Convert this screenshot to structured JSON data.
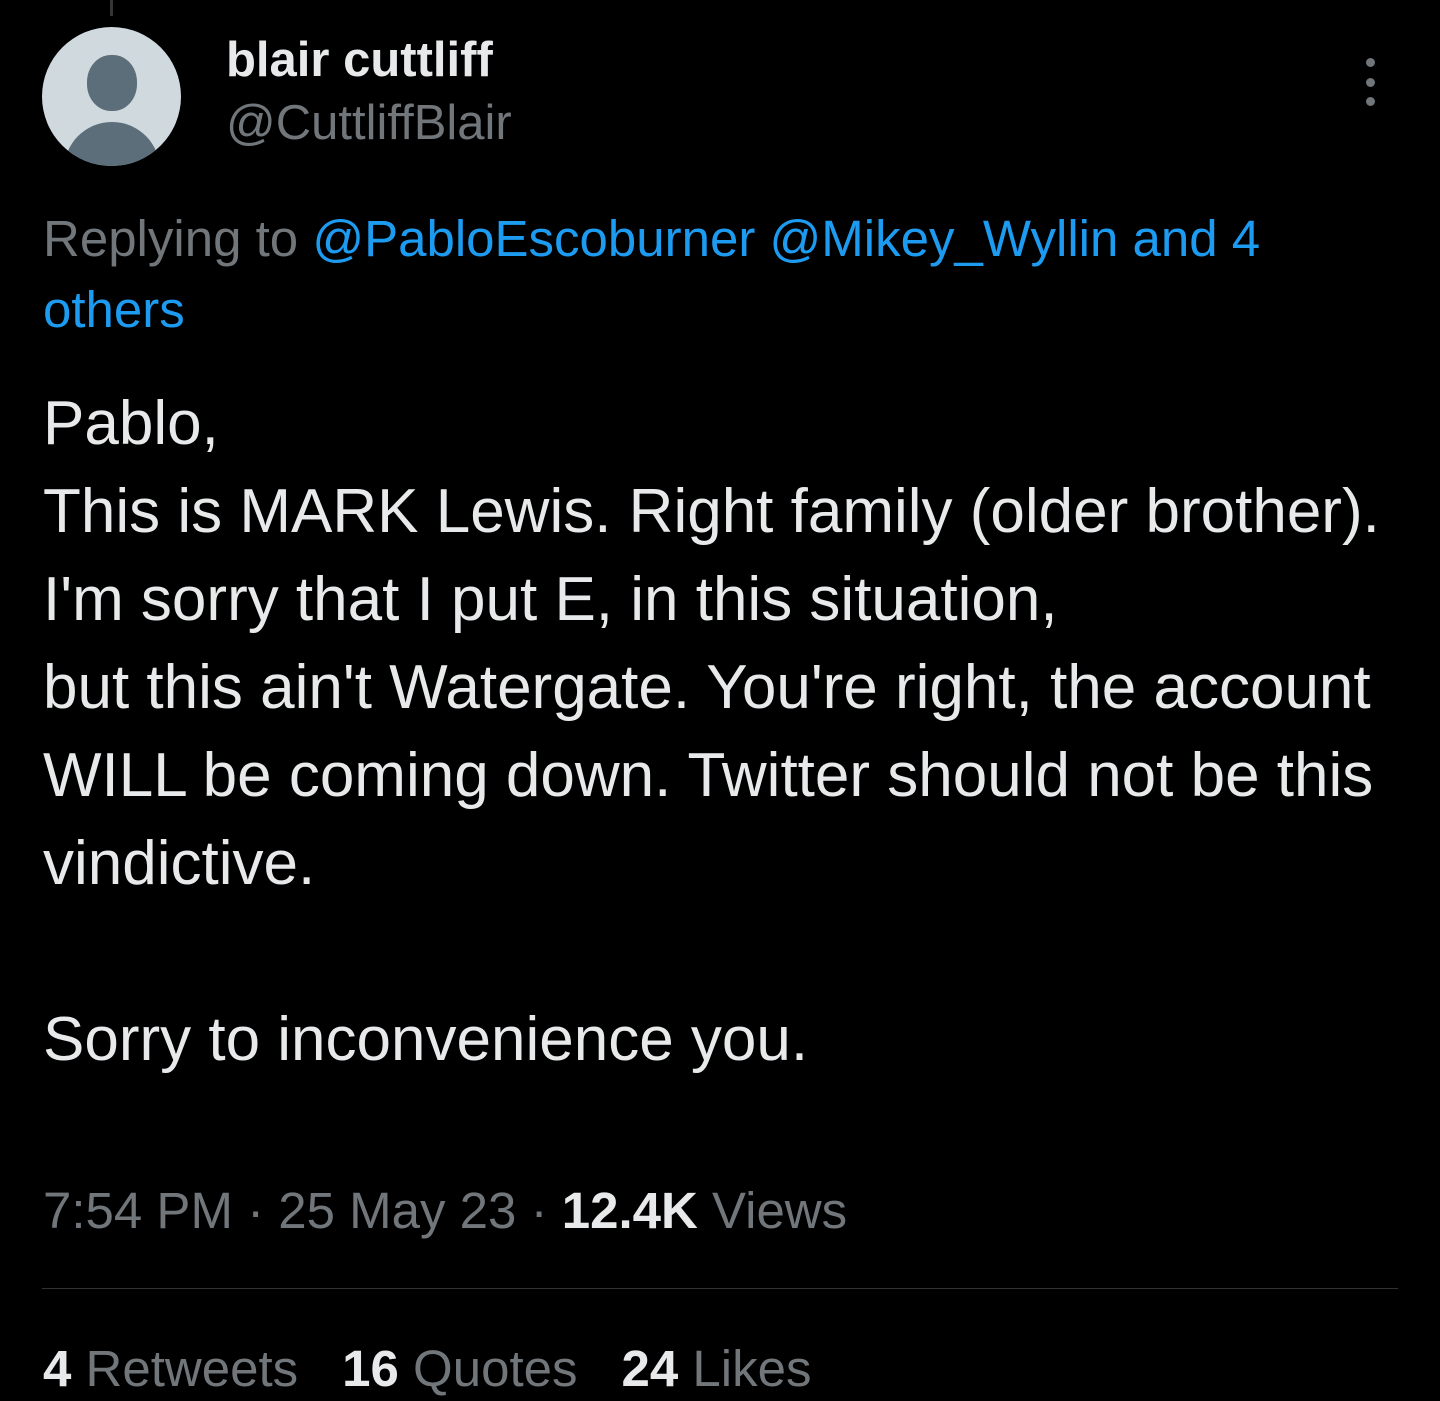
{
  "author": {
    "display_name": "blair cuttliff",
    "handle": "@CuttliffBlair",
    "avatar_icon": "default-profile-avatar-icon"
  },
  "menu": {
    "more_icon": "more-vertical-icon"
  },
  "reply": {
    "prefix": "Replying to",
    "mentions": [
      "@PabloEscoburner",
      "@Mikey_Wyllin"
    ],
    "suffix": "and 4 others"
  },
  "tweet": {
    "text": "Pablo,\nThis is MARK Lewis. Right family (older brother).\nI'm sorry that I put E, in this situation,\nbut this ain't Watergate. You're right, the account WILL be coming down. Twitter should not be this vindictive.\n\nSorry to inconvenience you."
  },
  "meta": {
    "time": "7:54 PM",
    "separator": "·",
    "date": "25 May 23",
    "views_count": "12.4K",
    "views_label": "Views"
  },
  "stats": {
    "retweets_count": "4",
    "retweets_label": "Retweets",
    "quotes_count": "16",
    "quotes_label": "Quotes",
    "likes_count": "24",
    "likes_label": "Likes"
  },
  "colors": {
    "background": "#000000",
    "primary_text": "#e7e9ea",
    "secondary_text": "#71767b",
    "link": "#1d9bf0",
    "divider": "#2f3336"
  }
}
